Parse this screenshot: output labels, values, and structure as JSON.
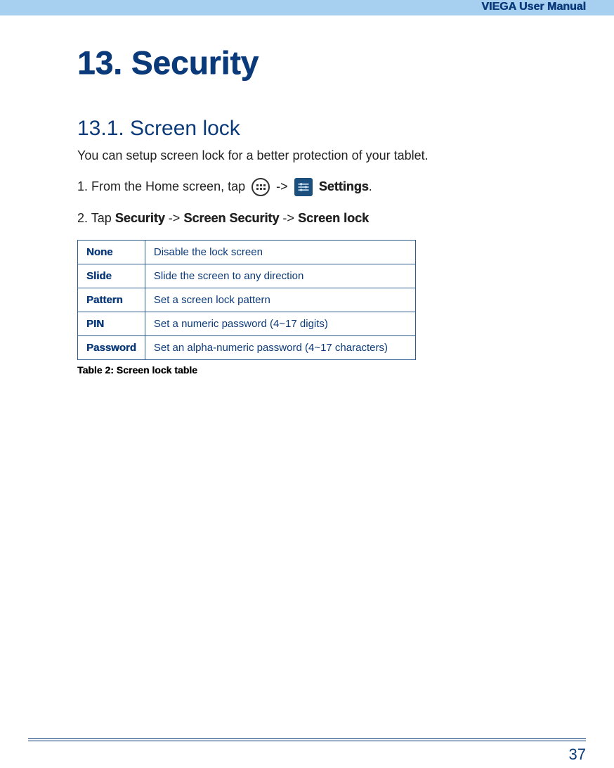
{
  "header": {
    "manual_title": "VIEGA User Manual"
  },
  "heading1": "13. Security",
  "heading2": "13.1. Screen lock",
  "intro": "You can setup screen lock for a better protection of your tablet.",
  "step1_prefix": "1. From the Home screen, tap",
  "arrow": "->",
  "settings_label": "Settings",
  "dot": ".",
  "step2_prefix": "2. Tap ",
  "step2_b1": "Security",
  "step2_b2": "Screen Security",
  "step2_b3": "Screen lock",
  "table_rows": [
    {
      "name": "None",
      "desc": "Disable the lock screen"
    },
    {
      "name": "Slide",
      "desc": "Slide the screen to any direction"
    },
    {
      "name": "Pattern",
      "desc": "Set a screen lock pattern"
    },
    {
      "name": "PIN",
      "desc": "Set a numeric password (4~17 digits)"
    },
    {
      "name": "Password",
      "desc": "Set an alpha-numeric password (4~17 characters)"
    }
  ],
  "table_caption": "Table 2: Screen lock table",
  "page_number": "37"
}
